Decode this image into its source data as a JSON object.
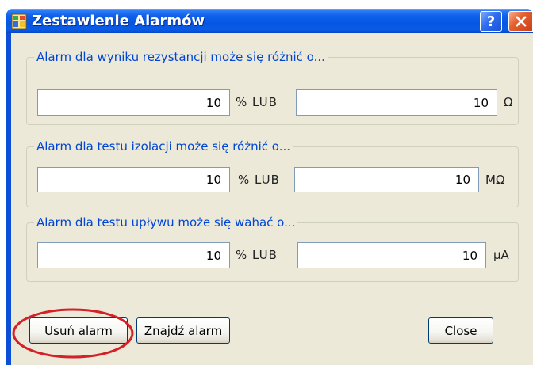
{
  "window": {
    "title": "Zestawienie Alarmów",
    "app_icon": "app-icon",
    "help_glyph": "?",
    "close_icon": "close-icon"
  },
  "alarm_groups": [
    {
      "legend": "Alarm dla wyniku rezystancji może się różnić o...",
      "percent_value": "10",
      "or_label": "% LUB",
      "absolute_value": "10",
      "unit": "Ω"
    },
    {
      "legend": "Alarm dla testu izolacji może się różnić o...",
      "percent_value": "10",
      "or_label": "% LUB",
      "absolute_value": "10",
      "unit": "MΩ"
    },
    {
      "legend": "Alarm dla testu upływu może się wahać o...",
      "percent_value": "10",
      "or_label": "% LUB",
      "absolute_value": "10",
      "unit": "μA"
    }
  ],
  "buttons": {
    "delete_alarm": "Usuń alarm",
    "find_alarm": "Znajdź alarm",
    "close": "Close"
  },
  "colors": {
    "titlebar": "#0556E2",
    "dialog_background": "#ECE9D8",
    "group_legend": "#0046D5",
    "highlight_ellipse": "#D42026"
  }
}
